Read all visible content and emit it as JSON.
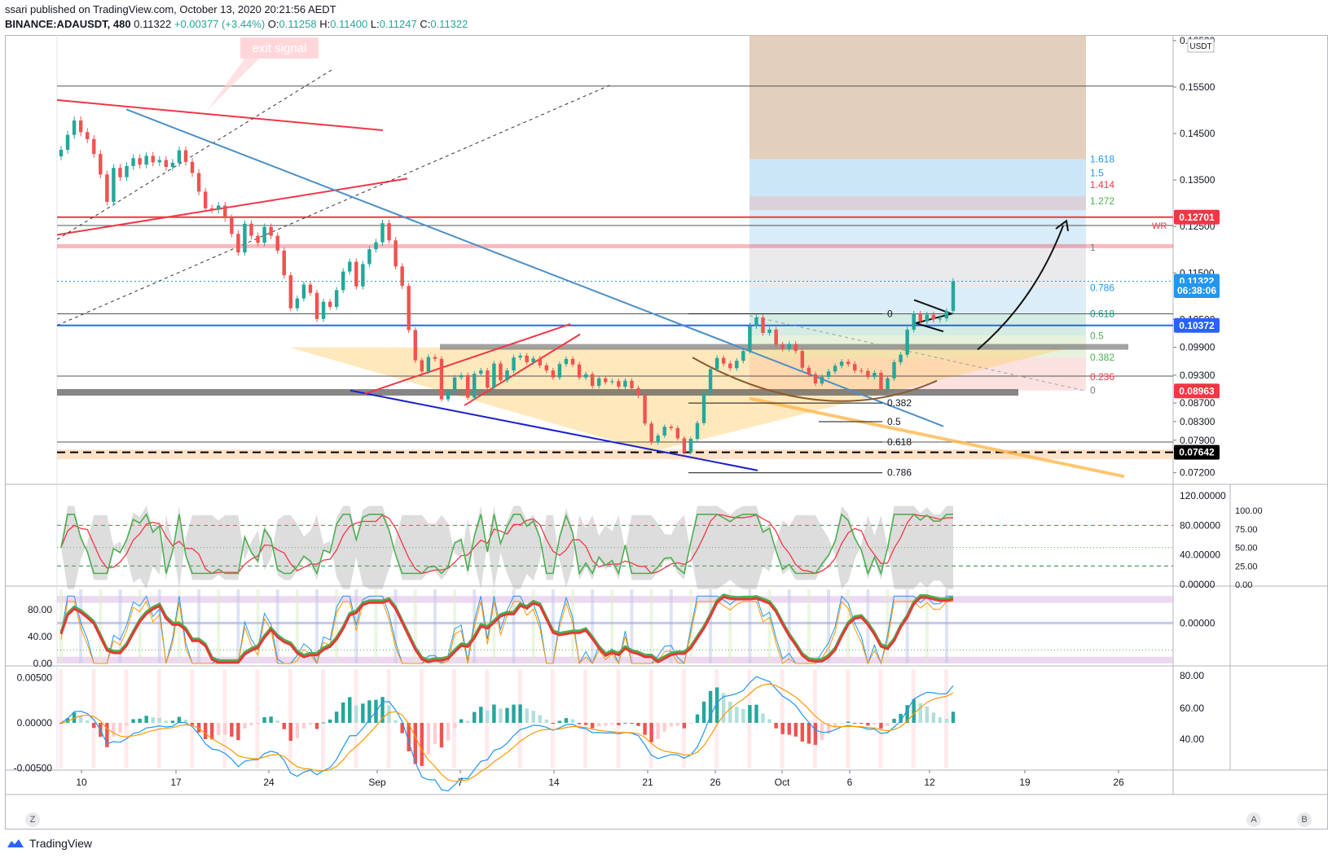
{
  "header": {
    "published": "ssari published on TradingView.com, October 13, 2020 20:21:56 AEDT",
    "symbol": "BINANCE:ADAUSDT, 480",
    "last": "0.11322",
    "change": "+0.00377 (+3.44%)",
    "open_label": "O:",
    "open": "0.11258",
    "high_label": "H:",
    "high": "0.11400",
    "low_label": "L:",
    "low": "0.11247",
    "close_label": "C:",
    "close": "0.11322"
  },
  "currency_badge": "USDT",
  "annotation_exit": "exit signal",
  "annotation_wr": "WR",
  "footer": {
    "brand": "TradingView"
  },
  "corner_buttons": {
    "left": "Z",
    "right_a": "A",
    "right_b": "B"
  },
  "colors": {
    "up": "#26a69a",
    "down": "#ef5350",
    "red_line": "#f23645",
    "blue_line": "#2962ff",
    "steel_line": "#4a8fc9",
    "triangle": "#ffd27a",
    "fib_blue": "#bde0f5",
    "fib_brown": "#d8bfa6"
  },
  "chart_data": [
    {
      "type": "candlestick",
      "title": "",
      "x_ticks": [
        "10",
        "17",
        "24",
        "Sep",
        "7",
        "14",
        "21",
        "26",
        "Oct",
        "6",
        "12",
        "19",
        "26"
      ],
      "y_ticks": [
        "0.16500",
        "0.15500",
        "0.14500",
        "0.13500",
        "0.12500",
        "0.11500",
        "0.10500",
        "0.09900",
        "0.09300",
        "0.08700",
        "0.08300",
        "0.07900",
        "0.07200"
      ],
      "ylim": [
        0.0695,
        0.1655
      ],
      "price_labels": [
        {
          "value": "0.12701",
          "color": "#f23645"
        },
        {
          "value": "0.11322",
          "color": "#2196f3"
        },
        {
          "value": "06:38:06",
          "color": "#2196f3"
        },
        {
          "value": "0.10372",
          "color": "#2962ff"
        },
        {
          "value": "0.08963",
          "color": "#f23645"
        },
        {
          "value": "0.07642",
          "color": "#000000"
        }
      ],
      "fib_extension_labels": [
        {
          "label": "1.618",
          "color": "#2196f3"
        },
        {
          "label": "1.5",
          "color": "#2196f3"
        },
        {
          "label": "1.414",
          "color": "#f23645"
        },
        {
          "label": "1.272",
          "color": "#4caf50"
        },
        {
          "label": "1",
          "color": "#787b86"
        },
        {
          "label": "0.786",
          "color": "#2196f3"
        },
        {
          "label": "0.618",
          "color": "#089981"
        },
        {
          "label": "0.5",
          "color": "#4caf50"
        },
        {
          "label": "0.382",
          "color": "#4caf50"
        },
        {
          "label": "0.236",
          "color": "#f23645"
        },
        {
          "label": "0",
          "color": "#787b86"
        }
      ],
      "fib_retrace_labels": [
        "0",
        "0.382",
        "0.5",
        "0.618",
        "0.786"
      ],
      "closes": [
        0.1415,
        0.1447,
        0.1478,
        0.1453,
        0.1438,
        0.1406,
        0.1362,
        0.1303,
        0.1376,
        0.1356,
        0.138,
        0.1397,
        0.1383,
        0.1402,
        0.1388,
        0.1393,
        0.1378,
        0.1387,
        0.1414,
        0.1389,
        0.1365,
        0.1325,
        0.1289,
        0.1286,
        0.1295,
        0.1268,
        0.1234,
        0.1194,
        0.1256,
        0.123,
        0.1215,
        0.1249,
        0.123,
        0.1198,
        0.1145,
        0.1074,
        0.1095,
        0.1125,
        0.1107,
        0.1051,
        0.1088,
        0.1077,
        0.1113,
        0.1153,
        0.1174,
        0.1121,
        0.1169,
        0.1201,
        0.1216,
        0.1257,
        0.122,
        0.1164,
        0.1122,
        0.1027,
        0.0962,
        0.0938,
        0.0969,
        0.0965,
        0.0878,
        0.0895,
        0.0925,
        0.093,
        0.0882,
        0.0933,
        0.094,
        0.0903,
        0.0955,
        0.0919,
        0.094,
        0.0968,
        0.0972,
        0.0958,
        0.0966,
        0.0951,
        0.094,
        0.0925,
        0.0954,
        0.0965,
        0.0953,
        0.0925,
        0.0932,
        0.0907,
        0.0923,
        0.0915,
        0.0917,
        0.0905,
        0.0918,
        0.0902,
        0.0886,
        0.0826,
        0.0785,
        0.08,
        0.0819,
        0.0816,
        0.0794,
        0.0764,
        0.0793,
        0.0827,
        0.0891,
        0.0943,
        0.0967,
        0.0955,
        0.0945,
        0.0961,
        0.0982,
        0.1036,
        0.1054,
        0.1021,
        0.1028,
        0.0996,
        0.0987,
        0.0997,
        0.0982,
        0.0946,
        0.0932,
        0.0912,
        0.0926,
        0.0938,
        0.095,
        0.0959,
        0.0954,
        0.094,
        0.0939,
        0.0926,
        0.0935,
        0.09,
        0.0923,
        0.0958,
        0.0974,
        0.1028,
        0.1062,
        0.1046,
        0.106,
        0.105,
        0.1052,
        0.1068,
        0.1132
      ],
      "rsi_ticks": [
        "120.00000",
        "80.00000",
        "40.00000",
        "0.00000"
      ],
      "rsi_right_ticks": [
        "100.00",
        "75.00",
        "50.00",
        "25.00",
        "0.00"
      ],
      "stoch_ticks": [
        "80.00",
        "40.00",
        "0.00"
      ],
      "stoch_right_ticks": [
        "0.00000"
      ],
      "macd_ticks": [
        "0.00500",
        "0.00000",
        "-0.00500"
      ],
      "macd_right_ticks": [
        "80.00",
        "60.00",
        "40.00"
      ]
    }
  ]
}
